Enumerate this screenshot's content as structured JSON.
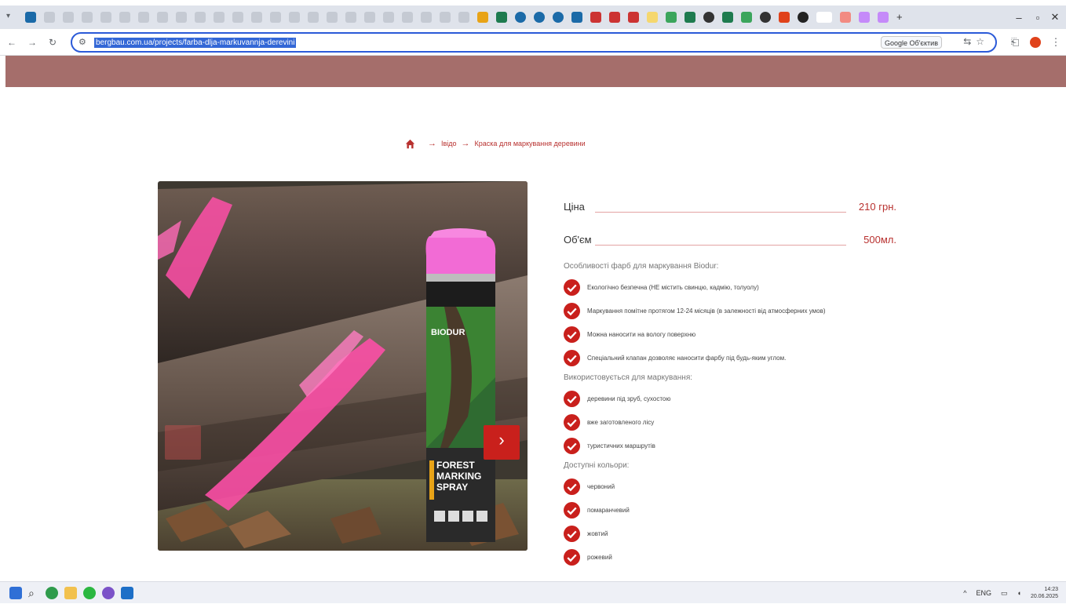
{
  "browser": {
    "url": "bergbau.com.ua/projects/farba-dlja-markuvannja-derevini",
    "translate_label": "Google Об'єктив"
  },
  "breadcrumb": {
    "items": [
      "Івідо",
      "Краска для маркування деревини"
    ]
  },
  "product": {
    "specs": [
      {
        "label": "Ціна",
        "value": "210 грн."
      },
      {
        "label": "Об'єм",
        "value": "500мл."
      }
    ],
    "sections": [
      {
        "title": "Особливості фарб для маркування Biodur:",
        "items": [
          "Екологічно безпечна (НЕ містить свинцю, кадмію, толуолу)",
          "Маркування помітне протягом 12-24 місяців (в залежності від атмосферних умов)",
          "Можна наносити на вологу поверхню",
          "Спеціальний клапан дозволяє наносити фарбу під будь-яким углом."
        ]
      },
      {
        "title": "Використовується для маркування:",
        "items": [
          "деревини під зруб, сухостою",
          "вже заготовленого лісу",
          "туристичних маршрутів"
        ]
      },
      {
        "title": "Доступні кольори:",
        "items": [
          "червоний",
          "помаранчевий",
          "жовтий",
          "рожевий"
        ]
      }
    ]
  },
  "photo": {
    "can_brand": "BIODUR",
    "can_text": [
      "FOREST",
      "MARKING",
      "SPRAY"
    ]
  },
  "taskbar": {
    "lang": "ENG",
    "time": "14:23",
    "date": "20.06.2025"
  },
  "colors": {
    "accent": "#b8312f",
    "banner": "#a56e6b",
    "check": "#c9201c"
  }
}
